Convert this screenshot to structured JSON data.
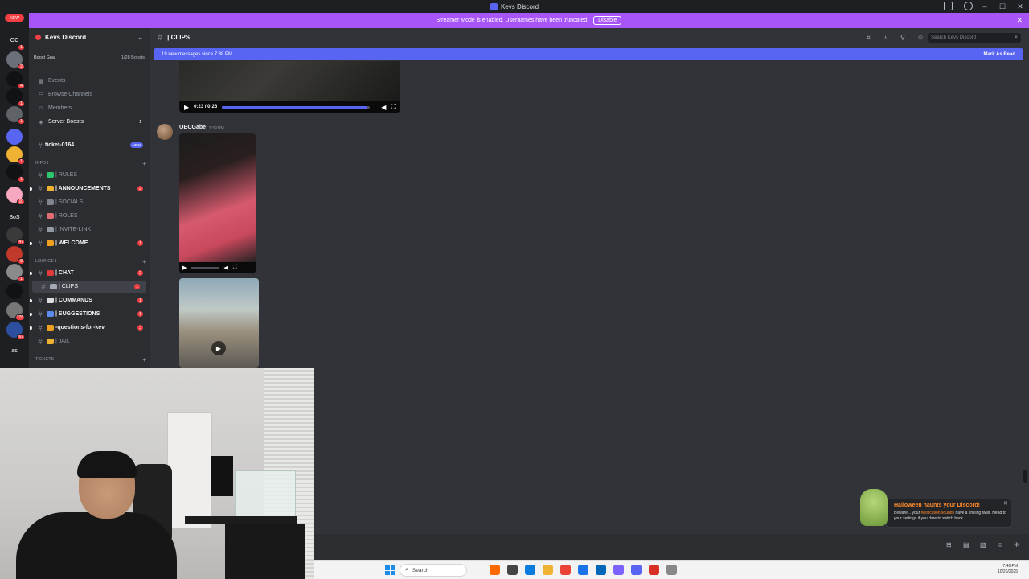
{
  "window": {
    "title": "Kevs Discord"
  },
  "streamer_banner": {
    "message": "Streamer Mode is enabled. Usernames have been truncated.",
    "disable_label": "Disable",
    "close": "✕"
  },
  "server_rail": {
    "new_label": "NEW",
    "servers": [
      {
        "label": "OC",
        "badge": "1",
        "color": "#1e1f22"
      },
      {
        "label": "",
        "badge": "2",
        "color": "#6b6f78"
      },
      {
        "label": "",
        "badge": "4",
        "color": "#111214"
      },
      {
        "label": "",
        "badge": "1",
        "color": "#111214"
      },
      {
        "label": "",
        "badge": "1",
        "color": "#5f6368"
      },
      {
        "label": "",
        "badge": "",
        "color": "#5865f2"
      },
      {
        "label": "",
        "badge": "1",
        "color": "#f0b232"
      },
      {
        "label": "",
        "badge": "1",
        "color": "#111214"
      },
      {
        "label": "",
        "badge": "10",
        "color": "#f7a8c0"
      },
      {
        "label": "SoS",
        "badge": "",
        "color": "#1e1f22"
      },
      {
        "label": "",
        "badge": "47",
        "color": "#3a3a3a"
      },
      {
        "label": "",
        "badge": "8",
        "color": "#c0392b"
      },
      {
        "label": "",
        "badge": "1",
        "color": "#8a8a8a"
      },
      {
        "label": "",
        "badge": "",
        "color": "#111214"
      },
      {
        "label": "",
        "badge": "176",
        "color": "#777"
      },
      {
        "label": "",
        "badge": "67",
        "color": "#2d4fa0"
      },
      {
        "label": "as",
        "badge": "",
        "color": "#1e1f22"
      }
    ]
  },
  "sidebar": {
    "server_name": "Kevs Discord",
    "boost_goal": "Boost Goal",
    "boost_count": "1/28 Boosts",
    "top_items": [
      {
        "icon": "▦",
        "label": "Events",
        "badge": ""
      },
      {
        "icon": "☷",
        "label": "Browse Channels",
        "badge": ""
      },
      {
        "icon": "☺",
        "label": "Members",
        "badge": ""
      },
      {
        "icon": "◈",
        "label": "Server Boosts",
        "badge": "1"
      }
    ],
    "ticket": {
      "label": "ticket-0164",
      "tag": "NEW"
    },
    "categories": [
      {
        "label": "INFO I"
      },
      {
        "label": "LOUNGE I"
      },
      {
        "label": "Tickets"
      }
    ],
    "info_channels": [
      {
        "label": "| RULES",
        "emoji": "#2dc770",
        "badge": "",
        "unread": false
      },
      {
        "label": "| ANNOUNCEMENTS",
        "emoji": "#f0b232",
        "badge": "2",
        "unread": true
      },
      {
        "label": "| SOCIALS",
        "emoji": "#80848e",
        "badge": "",
        "unread": false
      },
      {
        "label": "| ROLES",
        "emoji": "#e06c75",
        "badge": "",
        "unread": false
      },
      {
        "label": "| INVITE-LINK",
        "emoji": "#949ba4",
        "badge": "",
        "unread": false
      },
      {
        "label": "| WELCOME",
        "emoji": "#f0a020",
        "badge": "1",
        "unread": true
      }
    ],
    "lounge_channels": [
      {
        "label": "| CHAT",
        "emoji": "#e03a3a",
        "badge": "2",
        "unread": true,
        "active": false
      },
      {
        "label": "| CLIPS",
        "emoji": "#a5a9b2",
        "badge": "1",
        "unread": false,
        "active": true
      },
      {
        "label": "| COMMANDS",
        "emoji": "#dbdee1",
        "badge": "1",
        "unread": true,
        "active": false
      },
      {
        "label": "| SUGGESTIONS",
        "emoji": "#5b8def",
        "badge": "1",
        "unread": true,
        "active": false
      },
      {
        "label": "-questions-for-kev",
        "emoji": "#f0a020",
        "badge": "3",
        "unread": true,
        "active": false
      },
      {
        "label": "| JAIL",
        "emoji": "#f0b232",
        "badge": "",
        "unread": false,
        "active": false
      }
    ]
  },
  "channel_header": {
    "name": "| CLIPS",
    "search_placeholder": "Search Kevs Discord"
  },
  "new_messages_bar": {
    "text": "19 new messages since 7:38 PM",
    "mark_read": "Mark As Read"
  },
  "messages": [
    {
      "video_time": "0:23 / 0:26",
      "progress": 0.98
    },
    {
      "author": "OBCGabe",
      "time": "7:39 PM"
    }
  ],
  "toast": {
    "title": "Halloween haunts your Discord!",
    "text_prefix": "Beware... your ",
    "link": "notification sounds",
    "text_suffix": " have a chilling twist. Head to your settings if you dare to switch back.",
    "close": "✕"
  },
  "taskbar": {
    "search_label": "Search",
    "time": "7:46 PM",
    "date": "10/26/2025",
    "app_colors": [
      "#ff6a00",
      "#444",
      "#0a7ce0",
      "#f0b232",
      "#ea4335",
      "#1a73e8",
      "#0067b8",
      "#7b61ff",
      "#5865f2",
      "#d93025",
      "#888"
    ]
  }
}
